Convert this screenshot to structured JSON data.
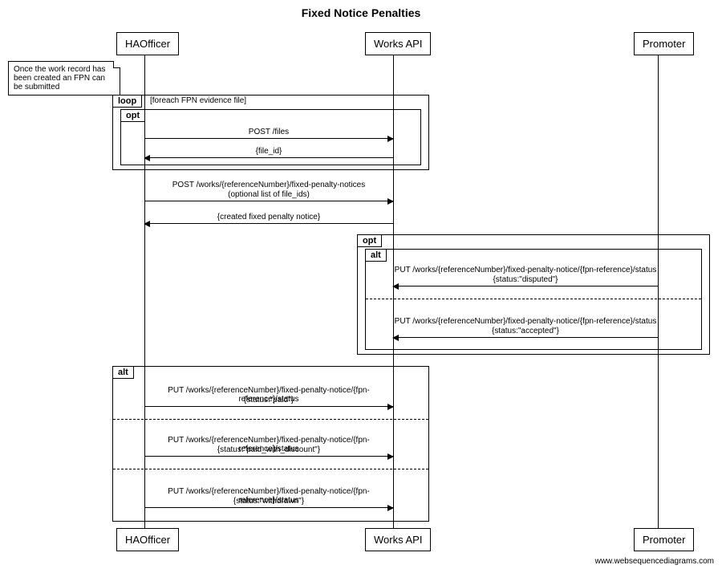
{
  "title": "Fixed Notice Penalties",
  "actors": {
    "ha": "HAOfficer",
    "api": "Works API",
    "promoter": "Promoter"
  },
  "note": "Once the work record has been created an FPN can be submitted",
  "frags": {
    "loop": {
      "label": "loop",
      "cond": "[foreach FPN evidence file]"
    },
    "opt_inner": {
      "label": "opt"
    },
    "opt_promoter": {
      "label": "opt"
    },
    "alt_promoter": {
      "label": "alt"
    },
    "alt_ha": {
      "label": "alt"
    }
  },
  "messages": {
    "post_files": {
      "label": "POST /files"
    },
    "file_id": {
      "label": "{file_id}"
    },
    "post_fpn": {
      "label": "POST /works/{referenceNumber}/fixed-penalty-notices",
      "label2": "(optional list of file_ids)"
    },
    "created_fpn": {
      "label": "{created fixed penalty notice}"
    },
    "put_disputed": {
      "label": "PUT /works/{referenceNumber}/fixed-penalty-notice/{fpn-reference}/status",
      "label2": "{status:\"disputed\"}"
    },
    "put_accepted": {
      "label": "PUT /works/{referenceNumber}/fixed-penalty-notice/{fpn-reference}/status",
      "label2": "{status:\"accepted\"}"
    },
    "put_paid": {
      "label": "PUT /works/{referenceNumber}/fixed-penalty-notice/{fpn-reference}/status",
      "label2": "{status:\"paid\"}"
    },
    "put_paid_discount": {
      "label": "PUT /works/{referenceNumber}/fixed-penalty-notice/{fpn-reference}/status",
      "label2": "{status:\"paid_with_discount\"}"
    },
    "put_withdrawn": {
      "label": "PUT /works/{referenceNumber}/fixed-penalty-notice/{fpn-reference}/status",
      "label2": "{status:\"withdrawn\"}"
    }
  },
  "footer": "www.websequencediagrams.com"
}
